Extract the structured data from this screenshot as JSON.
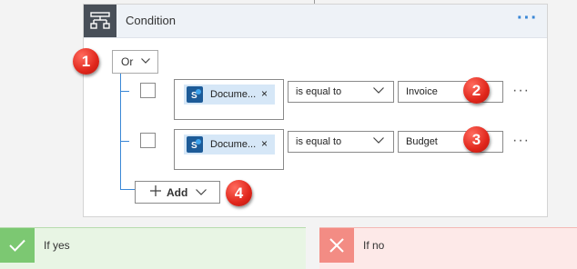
{
  "condition": {
    "title": "Condition",
    "more": "···",
    "group_operator": "Or"
  },
  "rows": [
    {
      "token_label": "Docume...",
      "token_remove": "×",
      "operator": "is equal to",
      "value": "Invoice",
      "more": "···"
    },
    {
      "token_label": "Docume...",
      "token_remove": "×",
      "operator": "is equal to",
      "value": "Budget",
      "more": "···"
    }
  ],
  "add_button": {
    "label": "Add"
  },
  "callouts": [
    "1",
    "2",
    "3",
    "4"
  ],
  "branches": {
    "yes_label": "If yes",
    "no_label": "If no"
  },
  "colors": {
    "accent": "#3a87d6",
    "callout": "#e0261b",
    "yes": "#7cc872",
    "no": "#f38c84",
    "header_icon_bg": "#484f58",
    "token_bg": "#d6e7f7"
  }
}
